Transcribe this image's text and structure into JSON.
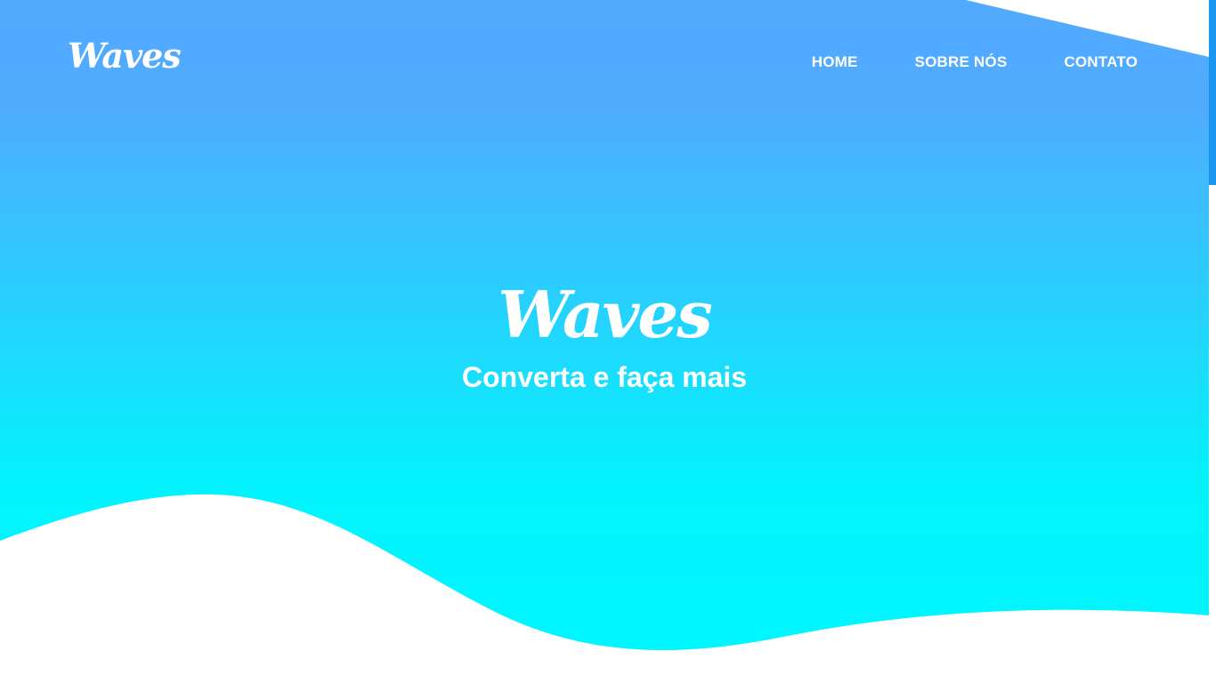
{
  "colors": {
    "gradient_top": "#52aaff",
    "gradient_bottom": "#00f6fe",
    "text": "#ffffff",
    "background": "#ffffff",
    "scrollbar": "#1a95f0"
  },
  "header": {
    "logo": "Waves",
    "nav": {
      "home": "HOME",
      "about": "SOBRE NÓS",
      "contact": "CONTATO"
    }
  },
  "hero": {
    "title": "Waves",
    "subtitle": "Converta e faça mais"
  }
}
